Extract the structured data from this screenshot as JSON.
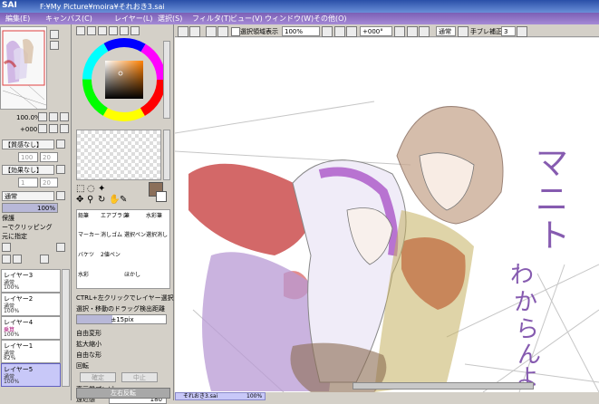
{
  "app": {
    "logo": "SAI",
    "path": "F:¥My Picture¥moira¥それおき3.sai"
  },
  "menu": [
    {
      "label": "編集(E)"
    },
    {
      "label": "キャンバス(C)"
    },
    {
      "label": "レイヤー(L)"
    },
    {
      "label": "選択(S)"
    },
    {
      "label": "フィルタ(T)"
    },
    {
      "label": "ビュー(V)"
    },
    {
      "label": "ウィンドウ(W)"
    },
    {
      "label": "その他(O)"
    }
  ],
  "navigator": {
    "zoom": "100.0%",
    "angle": "+000°"
  },
  "layer_props": {
    "texture": "【質感なし】",
    "texture_value": "100",
    "texture_value2": "20",
    "effect": "【効果なし】",
    "effect_value": "1",
    "effect_value2": "20",
    "blend_mode": "通常",
    "opacity": "100%",
    "checks": [
      "保護",
      "ーでクリッピング",
      "元に指定"
    ]
  },
  "layers": [
    {
      "name": "レイヤー3",
      "mode": "通常",
      "opacity": "100%"
    },
    {
      "name": "レイヤー2",
      "mode": "通常",
      "opacity": "100%"
    },
    {
      "name": "レイヤー4",
      "mode": "乗算",
      "opacity": "100%"
    },
    {
      "name": "レイヤー1",
      "mode": "通常",
      "opacity": "82%"
    },
    {
      "name": "レイヤー5",
      "mode": "通常",
      "opacity": "100%"
    }
  ],
  "tools": {
    "brush_labels": [
      "鉛筆",
      "エアブラシ",
      "筆",
      "水彩筆",
      "マーカー",
      "消しゴム",
      "選択ペン",
      "選択消し",
      "バケツ",
      "2値ペン",
      "水彩",
      "ほかし"
    ],
    "ctrl_option": "CTRL+左クリックでレイヤー選択",
    "drag_label": "選択・移動のドラッグ検出距離",
    "drag_value": "±15pix",
    "radios": [
      "自由変形",
      "拡大縮小",
      "自由な形",
      "回転"
    ],
    "ok_button": "確定",
    "cancel_button": "中止",
    "hq_preview": "高画質プレビュー",
    "perspective_label": "遠近感",
    "perspective_value": "180",
    "flip_button": "左右反転"
  },
  "canvas_toolbar": {
    "selection_label": "選択領域表示",
    "zoom": "100%",
    "angle": "+000°",
    "mode": "通常",
    "stabilizer_label": "手ブレ補正",
    "stabilizer_value": "3"
  },
  "canvas_text": "マニトわからんよ",
  "status": {
    "file": "それおき3.sai",
    "zoom": "100%"
  },
  "colors": {
    "title": "#2a4fa8",
    "menu": "#8a6ec4",
    "selection": "#c8c8f8",
    "brush_color": "#8b6f5a"
  }
}
